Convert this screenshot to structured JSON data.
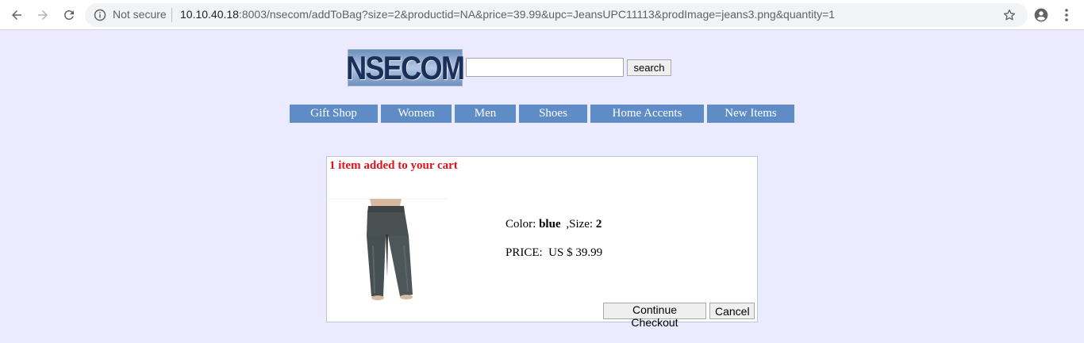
{
  "browser": {
    "security_label": "Not secure",
    "url_host": "10.10.40.18",
    "url_rest": ":8003/nsecom/addToBag?size=2&productid=NA&price=39.99&upc=JeansUPC11113&prodImage=jeans3.png&quantity=1"
  },
  "header": {
    "logo_text": "NSECOM",
    "search_value": "",
    "search_button": "search"
  },
  "nav": {
    "items": [
      "Gift Shop",
      "Women",
      "Men",
      "Shoes",
      "Home Accents",
      "New Items"
    ]
  },
  "cart": {
    "message": "1 item added to your cart",
    "color_label": "Color:",
    "color_value": "blue",
    "size_label": ",Size:",
    "size_value": "2",
    "price_text": "PRICE:  US $ 39.99",
    "continue_button": "Continue Checkout",
    "cancel_button": "Cancel"
  },
  "colors": {
    "page_bg": "#ebeafe",
    "nav_bg": "#5f8cc6",
    "message_red": "#e0121a"
  }
}
